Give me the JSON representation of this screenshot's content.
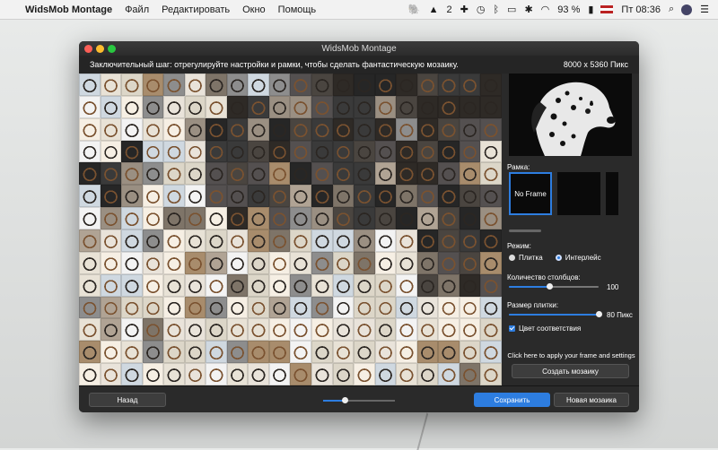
{
  "menubar": {
    "app_name": "WidsMob Montage",
    "menus": [
      "Файл",
      "Редактировать",
      "Окно",
      "Помощь"
    ],
    "status_badge": "2",
    "battery": "93 %",
    "clock": "Пт 08:36"
  },
  "window": {
    "title": "WidsMob Montage",
    "instruction": "Заключительный шаг: отрегулируйте настройки и рамки, чтобы сделать фантастическую мозаику.",
    "dimensions": "8000 x 5360 Пикс"
  },
  "panel": {
    "frame_label": "Рамка:",
    "frames": [
      "No Frame",
      "",
      ""
    ],
    "mode_label": "Режим:",
    "mode_options": [
      "Плитка",
      "Интерлейс"
    ],
    "mode_selected": "Интерлейс",
    "columns_label": "Количество столбцов:",
    "columns_value": "100",
    "columns_fraction": 0.45,
    "tile_size_label": "Размер плитки:",
    "tile_size_value": "80 Пикс",
    "tile_size_fraction": 1.0,
    "color_match_label": "Цвет соответствия",
    "color_match_checked": true,
    "apply_hint": "Click here to apply your frame and settings",
    "create_button": "Создать мозаику"
  },
  "bottombar": {
    "back_button": "Назад",
    "save_button": "Сохранить",
    "new_button": "Новая мозаика",
    "zoom_fraction": 0.3
  },
  "colors": {
    "accent": "#2d7de0",
    "window_bg": "#202020",
    "panel_bg": "#2a2a2a"
  }
}
